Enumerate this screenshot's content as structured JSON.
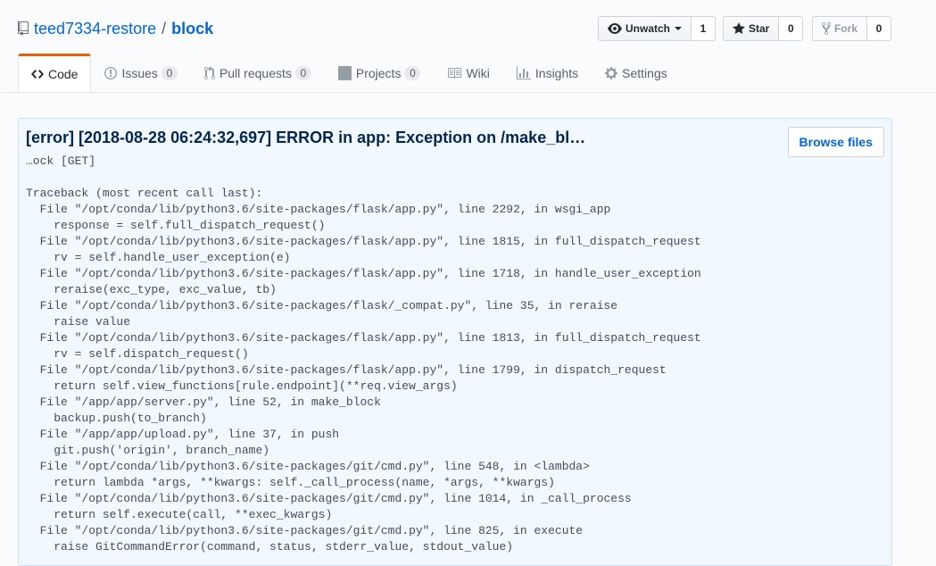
{
  "repo": {
    "owner": "teed7334-restore",
    "separator": "/",
    "name": "block"
  },
  "actions": {
    "watch": {
      "label": "Unwatch",
      "count": "1"
    },
    "star": {
      "label": "Star",
      "count": "0"
    },
    "fork": {
      "label": "Fork",
      "count": "0"
    }
  },
  "tabs": [
    {
      "label": "Code",
      "counter": null
    },
    {
      "label": "Issues",
      "counter": "0"
    },
    {
      "label": "Pull requests",
      "counter": "0"
    },
    {
      "label": "Projects",
      "counter": "0"
    },
    {
      "label": "Wiki",
      "counter": null
    },
    {
      "label": "Insights",
      "counter": null
    },
    {
      "label": "Settings",
      "counter": null
    }
  ],
  "commit": {
    "title": "[error] [2018-08-28 06:24:32,697] ERROR in app: Exception on /make_bl…",
    "browse_label": "Browse files",
    "description_lines": [
      "…ock [GET]",
      "",
      "Traceback (most recent call last):",
      "  File \"/opt/conda/lib/python3.6/site-packages/flask/app.py\", line 2292, in wsgi_app",
      "    response = self.full_dispatch_request()",
      "  File \"/opt/conda/lib/python3.6/site-packages/flask/app.py\", line 1815, in full_dispatch_request",
      "    rv = self.handle_user_exception(e)",
      "  File \"/opt/conda/lib/python3.6/site-packages/flask/app.py\", line 1718, in handle_user_exception",
      "    reraise(exc_type, exc_value, tb)",
      "  File \"/opt/conda/lib/python3.6/site-packages/flask/_compat.py\", line 35, in reraise",
      "    raise value",
      "  File \"/opt/conda/lib/python3.6/site-packages/flask/app.py\", line 1813, in full_dispatch_request",
      "    rv = self.dispatch_request()",
      "  File \"/opt/conda/lib/python3.6/site-packages/flask/app.py\", line 1799, in dispatch_request",
      "    return self.view_functions[rule.endpoint](**req.view_args)",
      "  File \"/app/app/server.py\", line 52, in make_block",
      "    backup.push(to_branch)",
      "  File \"/app/app/upload.py\", line 37, in push",
      "    git.push('origin', branch_name)",
      "  File \"/opt/conda/lib/python3.6/site-packages/git/cmd.py\", line 548, in <lambda>",
      "    return lambda *args, **kwargs: self._call_process(name, *args, **kwargs)",
      "  File \"/opt/conda/lib/python3.6/site-packages/git/cmd.py\", line 1014, in _call_process",
      "    return self.execute(call, **exec_kwargs)",
      "  File \"/opt/conda/lib/python3.6/site-packages/git/cmd.py\", line 825, in execute",
      "    raise GitCommandError(command, status, stderr_value, stdout_value)"
    ]
  }
}
